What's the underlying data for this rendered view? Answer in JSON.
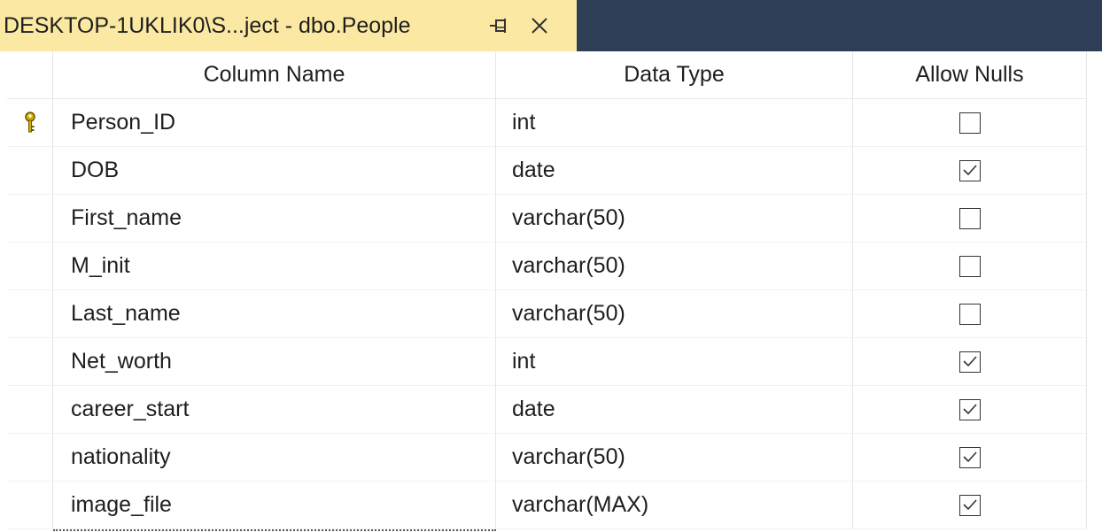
{
  "tab": {
    "title": "DESKTOP-1UKLIK0\\S...ject - dbo.People"
  },
  "columns": {
    "column_name": "Column Name",
    "data_type": "Data Type",
    "allow_nulls": "Allow Nulls"
  },
  "rows": [
    {
      "name": "Person_ID",
      "type": "int",
      "allow_nulls": false,
      "primary_key": true
    },
    {
      "name": "DOB",
      "type": "date",
      "allow_nulls": true,
      "primary_key": false
    },
    {
      "name": "First_name",
      "type": "varchar(50)",
      "allow_nulls": false,
      "primary_key": false
    },
    {
      "name": "M_init",
      "type": "varchar(50)",
      "allow_nulls": false,
      "primary_key": false
    },
    {
      "name": "Last_name",
      "type": "varchar(50)",
      "allow_nulls": false,
      "primary_key": false
    },
    {
      "name": "Net_worth",
      "type": "int",
      "allow_nulls": true,
      "primary_key": false
    },
    {
      "name": "career_start",
      "type": "date",
      "allow_nulls": true,
      "primary_key": false
    },
    {
      "name": "nationality",
      "type": "varchar(50)",
      "allow_nulls": true,
      "primary_key": false
    },
    {
      "name": "image_file",
      "type": "varchar(MAX)",
      "allow_nulls": true,
      "primary_key": false
    }
  ],
  "colors": {
    "tab_active": "#fbe9a3",
    "tab_strip": "#2e3e57",
    "key_icon": "#d4b000"
  },
  "icons": {
    "pin": "pin-icon",
    "close": "close-icon",
    "primary_key": "key-icon",
    "checked": "checkmark-icon"
  }
}
